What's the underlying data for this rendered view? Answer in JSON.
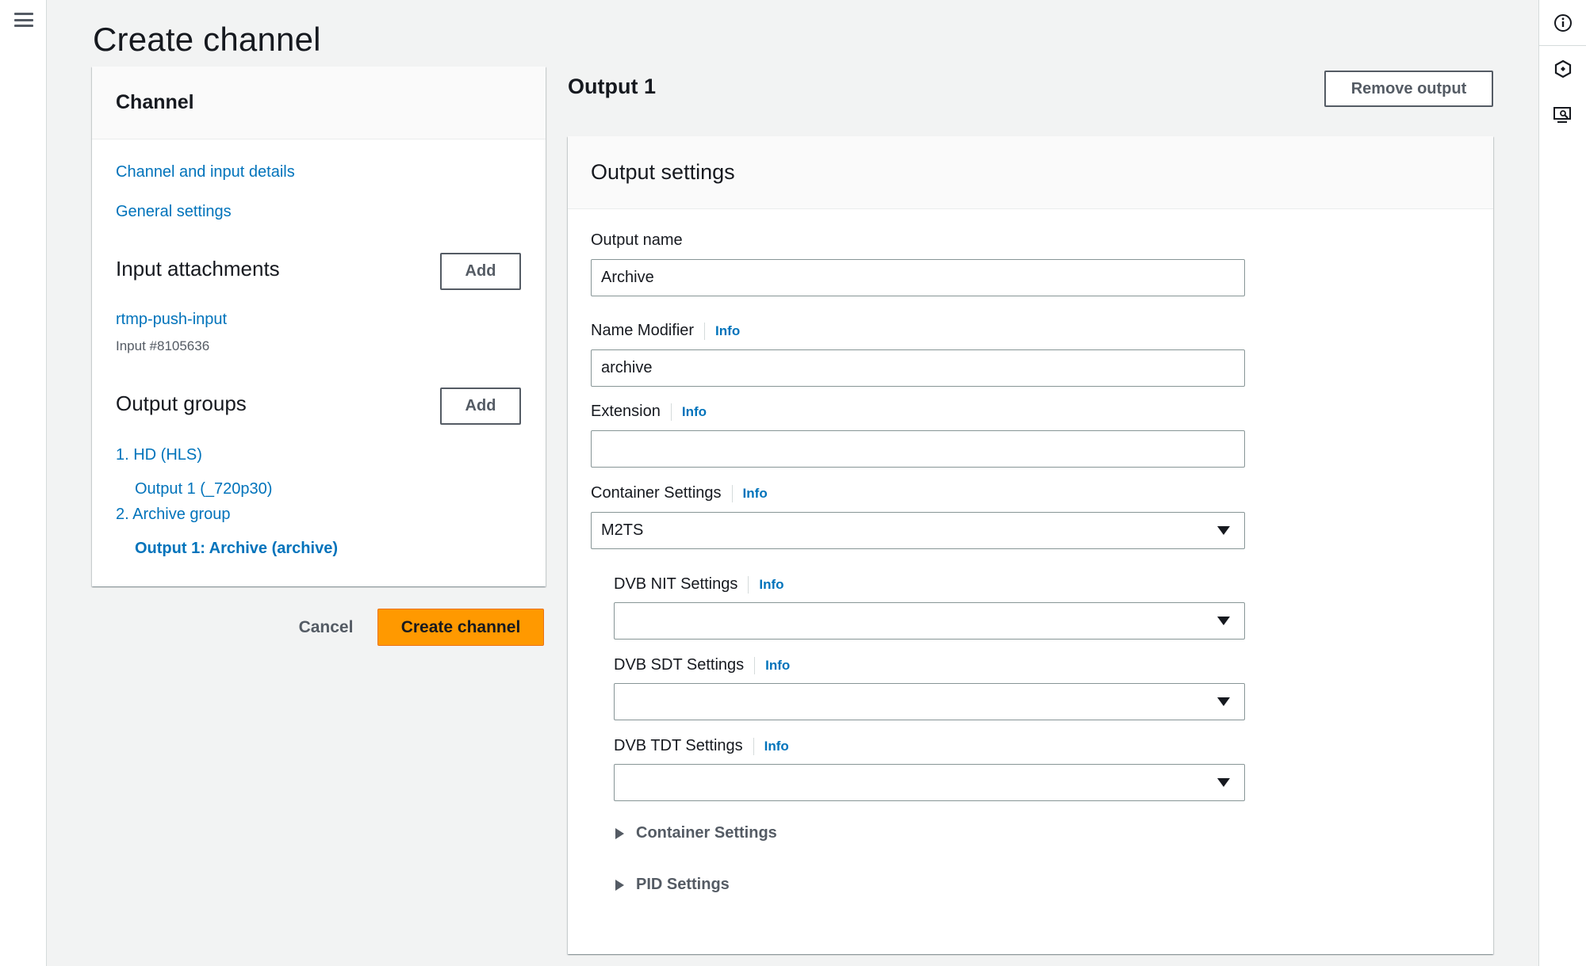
{
  "page": {
    "title": "Create channel"
  },
  "nav": {
    "header": "Channel",
    "links": [
      "Channel and input details",
      "General settings"
    ],
    "input_attachments": {
      "title": "Input attachments",
      "add_label": "Add",
      "item_name": "rtmp-push-input",
      "item_meta": "Input #8105636"
    },
    "output_groups": {
      "title": "Output groups",
      "add_label": "Add",
      "groups": [
        {
          "label": "1. HD (HLS)",
          "output": "Output 1 (_720p30)"
        },
        {
          "label": "2. Archive group",
          "output": "Output 1: Archive (archive)"
        }
      ]
    }
  },
  "actions": {
    "cancel": "Cancel",
    "create": "Create channel"
  },
  "output": {
    "title": "Output 1",
    "remove_label": "Remove output",
    "panel_title": "Output settings",
    "info_label": "Info",
    "output_name": {
      "label": "Output name",
      "value": "Archive"
    },
    "name_modifier": {
      "label": "Name Modifier",
      "value": "archive"
    },
    "extension": {
      "label": "Extension",
      "value": ""
    },
    "container_settings": {
      "label": "Container Settings",
      "value": "M2TS"
    },
    "dvb_nit": {
      "label": "DVB NIT Settings",
      "value": ""
    },
    "dvb_sdt": {
      "label": "DVB SDT Settings",
      "value": ""
    },
    "dvb_tdt": {
      "label": "DVB TDT Settings",
      "value": ""
    },
    "expanders": [
      "Container Settings",
      "PID Settings"
    ]
  },
  "icons": {
    "menu": "hamburger-menu-icon",
    "info": "info-circle-icon",
    "feedback": "hexagon-feedback-icon",
    "screen": "monitor-search-icon"
  },
  "colors": {
    "link": "#0073bb",
    "primary_button": "#ff9900",
    "background": "#f2f3f3"
  }
}
